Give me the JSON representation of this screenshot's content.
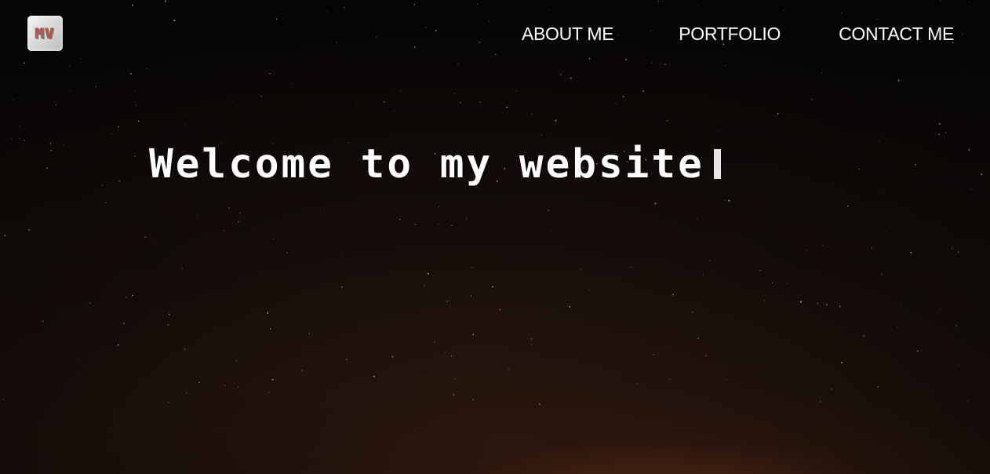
{
  "logo": {
    "text": "MV"
  },
  "nav": {
    "items": [
      {
        "label": "ABOUT ME"
      },
      {
        "label": "PORTFOLIO"
      },
      {
        "label": "CONTACT ME"
      }
    ]
  },
  "hero": {
    "headline": "Welcome to my website"
  },
  "colors": {
    "text": "#ffffff",
    "background": "#0b0706",
    "glow": "#783c19"
  }
}
